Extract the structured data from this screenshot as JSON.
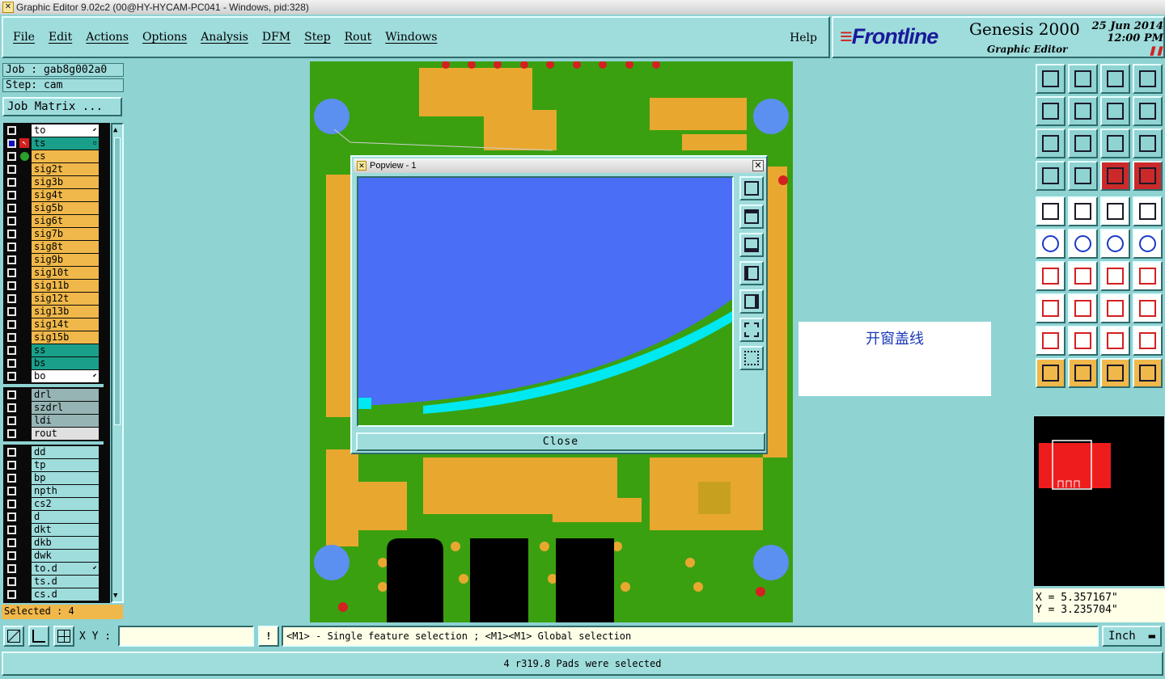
{
  "window": {
    "title": "Graphic Editor 9.02c2 (00@HY-HYCAM-PC041 - Windows, pid:328)"
  },
  "menu": {
    "items": [
      "File",
      "Edit",
      "Actions",
      "Options",
      "Analysis",
      "DFM",
      "Step",
      "Rout",
      "Windows"
    ],
    "help": "Help"
  },
  "brand": {
    "logo_main": "Frontline",
    "product": "Genesis 2000",
    "subtitle": "Graphic Editor",
    "date": "25 Jun 2014",
    "time": "12:00 PM"
  },
  "job": {
    "job_label": "Job : gab8g002a0",
    "step_label": "Step: cam",
    "matrix_button": "Job Matrix ..."
  },
  "layers": {
    "group1": [
      {
        "name": "to",
        "color": "#ffffff",
        "mark": "⬋"
      },
      {
        "name": "ts",
        "color": "#1aa08a",
        "mark": "▫"
      },
      {
        "name": "cs",
        "color": "#f0b84a",
        "mark": ""
      },
      {
        "name": "sig2t",
        "color": "#f0b84a",
        "mark": ""
      },
      {
        "name": "sig3b",
        "color": "#f0b84a",
        "mark": ""
      },
      {
        "name": "sig4t",
        "color": "#f0b84a",
        "mark": ""
      },
      {
        "name": "sig5b",
        "color": "#f0b84a",
        "mark": ""
      },
      {
        "name": "sig6t",
        "color": "#f0b84a",
        "mark": ""
      },
      {
        "name": "sig7b",
        "color": "#f0b84a",
        "mark": ""
      },
      {
        "name": "sig8t",
        "color": "#f0b84a",
        "mark": ""
      },
      {
        "name": "sig9b",
        "color": "#f0b84a",
        "mark": ""
      },
      {
        "name": "sig10t",
        "color": "#f0b84a",
        "mark": ""
      },
      {
        "name": "sig11b",
        "color": "#f0b84a",
        "mark": ""
      },
      {
        "name": "sig12t",
        "color": "#f0b84a",
        "mark": ""
      },
      {
        "name": "sig13b",
        "color": "#f0b84a",
        "mark": ""
      },
      {
        "name": "sig14t",
        "color": "#f0b84a",
        "mark": ""
      },
      {
        "name": "sig15b",
        "color": "#f0b84a",
        "mark": ""
      },
      {
        "name": "ss",
        "color": "#1aa08a",
        "mark": ""
      },
      {
        "name": "bs",
        "color": "#1aa08a",
        "mark": ""
      },
      {
        "name": "bo",
        "color": "#ffffff",
        "mark": "⬋"
      }
    ],
    "group2": [
      {
        "name": "drl",
        "color": "#96b4b4",
        "mark": ""
      },
      {
        "name": "szdrl",
        "color": "#96b4b4",
        "mark": ""
      },
      {
        "name": "ldi",
        "color": "#96b4b4",
        "mark": ""
      },
      {
        "name": "rout",
        "color": "#e0e0e0",
        "mark": ""
      }
    ],
    "group3": [
      {
        "name": "dd",
        "color": "#9fdcdc",
        "mark": ""
      },
      {
        "name": "tp",
        "color": "#9fdcdc",
        "mark": ""
      },
      {
        "name": "bp",
        "color": "#9fdcdc",
        "mark": ""
      },
      {
        "name": "npth",
        "color": "#9fdcdc",
        "mark": ""
      },
      {
        "name": "cs2",
        "color": "#9fdcdc",
        "mark": ""
      },
      {
        "name": "d",
        "color": "#9fdcdc",
        "mark": ""
      },
      {
        "name": "dkt",
        "color": "#9fdcdc",
        "mark": ""
      },
      {
        "name": "dkb",
        "color": "#9fdcdc",
        "mark": ""
      },
      {
        "name": "dwk",
        "color": "#9fdcdc",
        "mark": ""
      },
      {
        "name": "to.d",
        "color": "#9fdcdc",
        "mark": "⬋"
      },
      {
        "name": "ts.d",
        "color": "#9fdcdc",
        "mark": ""
      },
      {
        "name": "cs.d",
        "color": "#9fdcdc",
        "mark": ""
      }
    ]
  },
  "selected": "Selected : 4",
  "popup": {
    "title": "Popview - 1",
    "close_button": "Close"
  },
  "annotation": "开窗盖线",
  "coords": {
    "x": "X = 5.357167\"",
    "y": "Y = 3.235704\""
  },
  "bottom": {
    "xy_label": "X Y :",
    "xy_value": "",
    "warn": "!",
    "prompt": "<M1> - Single feature selection ; <M1><M1> Global selection",
    "units": "Inch"
  },
  "status": "4 r319.8 Pads were selected",
  "colors": {
    "panel": "#8fd3d3",
    "board": "#3aa010",
    "pad": "#e8a830",
    "hole": "#5b8ff0",
    "solder_arc": "#00e8f0"
  }
}
